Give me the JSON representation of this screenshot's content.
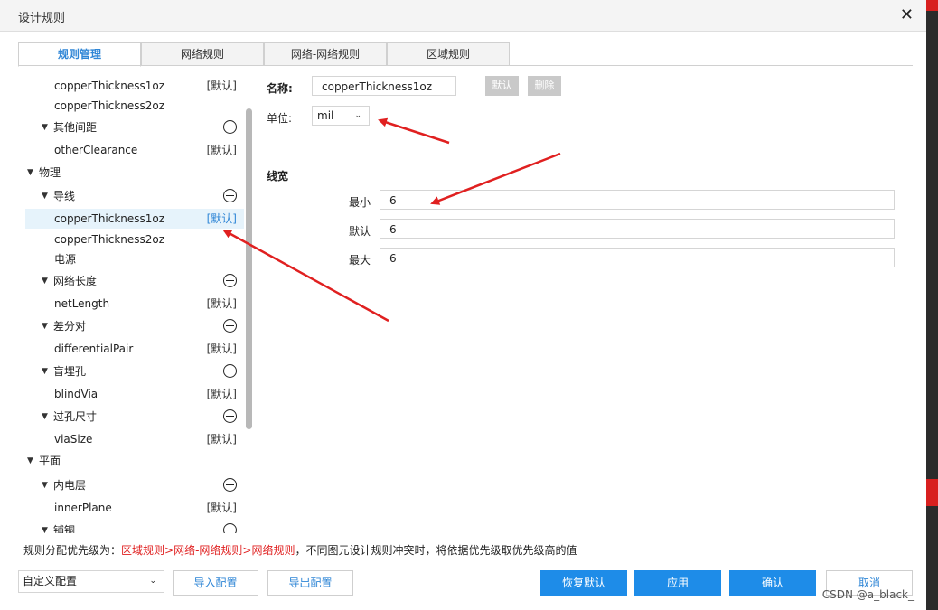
{
  "window": {
    "title": "设计规则",
    "close_glyph": "✕"
  },
  "tabs": [
    {
      "label": "规则管理",
      "active": true
    },
    {
      "label": "网络规则",
      "active": false
    },
    {
      "label": "网络-网络规则",
      "active": false
    },
    {
      "label": "区域规则",
      "active": false
    }
  ],
  "tree": [
    {
      "label": "copperThickness1oz",
      "level": 2,
      "default": "[默认]"
    },
    {
      "label": "copperThickness2oz",
      "level": 2
    },
    {
      "label": "其他间距",
      "level": 1,
      "expandable": true,
      "add": true
    },
    {
      "label": "otherClearance",
      "level": 2,
      "default": "[默认]"
    },
    {
      "label": "物理",
      "level": 0,
      "expandable": true
    },
    {
      "label": "导线",
      "level": 1,
      "expandable": true,
      "add": true
    },
    {
      "label": "copperThickness1oz",
      "level": 2,
      "default": "[默认]",
      "selected": true
    },
    {
      "label": "copperThickness2oz",
      "level": 2
    },
    {
      "label": "电源",
      "level": 2
    },
    {
      "label": "网络长度",
      "level": 1,
      "expandable": true,
      "add": true
    },
    {
      "label": "netLength",
      "level": 2,
      "default": "[默认]"
    },
    {
      "label": "差分对",
      "level": 1,
      "expandable": true,
      "add": true
    },
    {
      "label": "differentialPair",
      "level": 2,
      "default": "[默认]"
    },
    {
      "label": "盲埋孔",
      "level": 1,
      "expandable": true,
      "add": true
    },
    {
      "label": "blindVia",
      "level": 2,
      "default": "[默认]"
    },
    {
      "label": "过孔尺寸",
      "level": 1,
      "expandable": true,
      "add": true
    },
    {
      "label": "viaSize",
      "level": 2,
      "default": "[默认]"
    },
    {
      "label": "平面",
      "level": 0,
      "expandable": true
    },
    {
      "label": "内电层",
      "level": 1,
      "expandable": true,
      "add": true
    },
    {
      "label": "innerPlane",
      "level": 2,
      "default": "[默认]"
    },
    {
      "label": "铺铜",
      "level": 1,
      "expandable": true,
      "add": true
    }
  ],
  "form": {
    "name_label": "名称:",
    "name_value": "copperThickness1oz",
    "default_btn": "默认",
    "delete_btn": "删除",
    "unit_label": "单位:",
    "unit_value": "mil",
    "section_title": "线宽",
    "min_label": "最小",
    "min_value": "6",
    "default_label": "默认",
    "default_value": "6",
    "max_label": "最大",
    "max_value": "6"
  },
  "priority": {
    "prefix": "规则分配优先级为：",
    "order": "区域规则>网络-网络规则>网络规则",
    "suffix": "，不同图元设计规则冲突时，将依据优先级取优先级高的值"
  },
  "footer": {
    "config_value": "自定义配置",
    "import_btn": "导入配置",
    "export_btn": "导出配置",
    "restore_btn": "恢复默认",
    "apply_btn": "应用",
    "confirm_btn": "确认",
    "cancel_btn": "取消"
  },
  "watermark": "CSDN @a_black_",
  "colors": {
    "accent": "#1e8ce8",
    "annotation_red": "#e02020"
  }
}
